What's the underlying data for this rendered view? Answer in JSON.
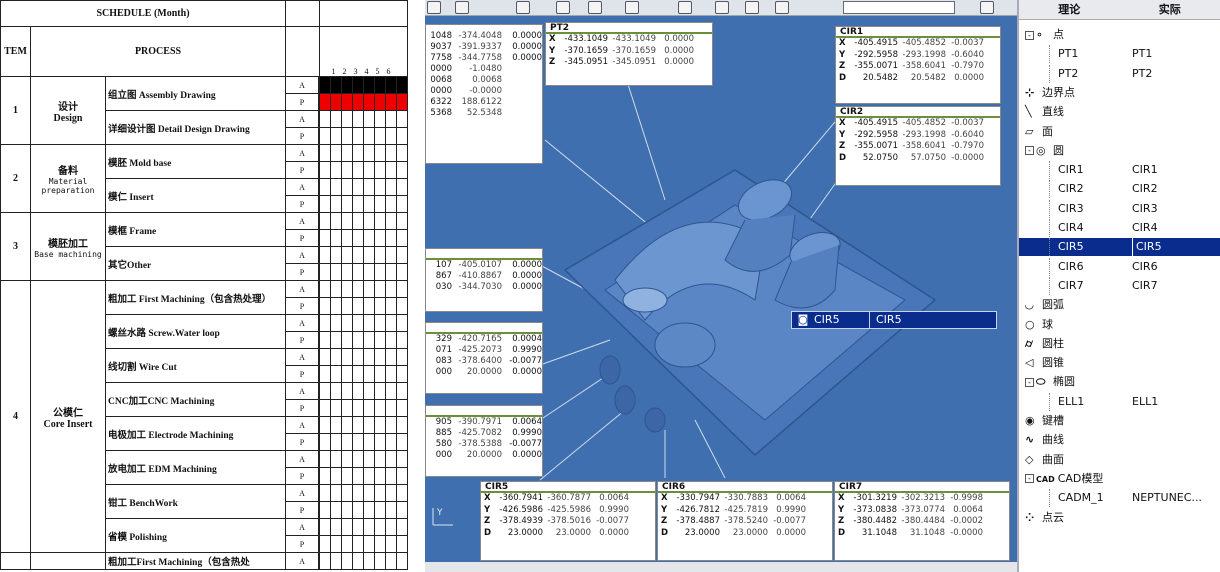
{
  "schedule": {
    "header_schedule": "SCHEDULE (Month)",
    "header_item": "TEM",
    "header_process": "PROCESS",
    "months": [
      "1",
      "2",
      "3",
      "4",
      "5",
      "6"
    ],
    "groups": [
      {
        "no": "1",
        "name_cn": "设计",
        "name_en": "Design",
        "rows": [
          {
            "label": "组立图 Assembly Drawing",
            "marks": [
              "A",
              "P"
            ]
          },
          {
            "label": "详细设计图  Detail Design Drawing",
            "marks": [
              "A",
              "P"
            ]
          }
        ]
      },
      {
        "no": "2",
        "name_cn": "备料",
        "name_en": "Material preparation",
        "rows": [
          {
            "label": "模胚 Mold base",
            "marks": [
              "A",
              "P"
            ]
          },
          {
            "label": "模仁 Insert",
            "marks": [
              "A",
              "P"
            ]
          }
        ]
      },
      {
        "no": "3",
        "name_cn": "模胚加工",
        "name_en": "Base machining",
        "rows": [
          {
            "label": "模框 Frame",
            "marks": [
              "A",
              "P"
            ]
          },
          {
            "label": "其它Other",
            "marks": [
              "A",
              "P"
            ]
          }
        ]
      },
      {
        "no": "4",
        "name_cn": "公模仁",
        "name_en": "Core Insert",
        "rows": [
          {
            "label": "粗加工 First Machining（包含热处理）",
            "marks": [
              "A",
              "P"
            ]
          },
          {
            "label": "螺丝水路 Screw.Water loop",
            "marks": [
              "A",
              "P"
            ]
          },
          {
            "label": "线切割 Wire Cut",
            "marks": [
              "A",
              "P"
            ]
          },
          {
            "label": "CNC加工CNC Machining",
            "marks": [
              "A",
              "P"
            ]
          },
          {
            "label": "电极加工 Electrode Machining",
            "marks": [
              "A",
              "P"
            ]
          },
          {
            "label": "放电加工 EDM Machining",
            "marks": [
              "A",
              "P"
            ]
          },
          {
            "label": "钳工 BenchWork",
            "marks": [
              "A",
              "P"
            ]
          },
          {
            "label": "省模 Polishing",
            "marks": [
              "A",
              "P"
            ]
          }
        ]
      }
    ],
    "last_row": {
      "label": "粗加工First Machining（包含热处",
      "mark": "A"
    }
  },
  "cad": {
    "panel_top_left": {
      "rows": [
        [
          "1048",
          "-374.4048",
          "0.0000"
        ],
        [
          "9037",
          "-391.9337",
          "0.0000"
        ],
        [
          "7758",
          "-344.7758",
          "0.0000"
        ],
        [
          "0000",
          "-1.0480",
          ""
        ],
        [
          "0068",
          "0.0068",
          ""
        ],
        [
          "0000",
          "-0.0000",
          ""
        ],
        [
          "6322",
          "188.6122",
          ""
        ],
        [
          "5368",
          "52.5348",
          ""
        ]
      ]
    },
    "panel_pt2": {
      "title": "PT2",
      "rows": [
        {
          "axis": "X",
          "a": "-433.1049",
          "b": "-433.1049",
          "c": "0.0000"
        },
        {
          "axis": "Y",
          "a": "-370.1659",
          "b": "-370.1659",
          "c": "0.0000"
        },
        {
          "axis": "Z",
          "a": "-345.0951",
          "b": "-345.0951",
          "c": "0.0000"
        }
      ]
    },
    "panel_cir1": {
      "title": "CIR1",
      "rows": [
        {
          "axis": "X",
          "a": "-405.4915",
          "b": "-405.4852",
          "c": "-0.0037"
        },
        {
          "axis": "Y",
          "a": "-292.5958",
          "b": "-293.1998",
          "c": "-0.6040"
        },
        {
          "axis": "Z",
          "a": "-355.0071",
          "b": "-358.6041",
          "c": "-0.7970"
        },
        {
          "axis": "D",
          "a": "20.5482",
          "b": "20.5482",
          "c": "0.0000"
        }
      ]
    },
    "panel_cir2": {
      "title": "CIR2",
      "rows": [
        {
          "axis": "X",
          "a": "-405.4915",
          "b": "-405.4852",
          "c": "-0.0037"
        },
        {
          "axis": "Y",
          "a": "-292.5958",
          "b": "-293.1998",
          "c": "-0.6040"
        },
        {
          "axis": "Z",
          "a": "-355.0071",
          "b": "-358.6041",
          "c": "-0.7970"
        },
        {
          "axis": "D",
          "a": "52.0750",
          "b": "57.0750",
          "c": "-0.0000"
        }
      ]
    },
    "panel_mid1": {
      "rows": [
        [
          "107",
          "-405.0107",
          "0.0000"
        ],
        [
          "867",
          "-410.8867",
          "0.0000"
        ],
        [
          "030",
          "-344.7030",
          "0.0000"
        ]
      ]
    },
    "panel_mid2": {
      "rows": [
        [
          "329",
          "-420.7165",
          "0.0004"
        ],
        [
          "071",
          "-425.2073",
          "0.9990"
        ],
        [
          "083",
          "-378.6400",
          "-0.0077"
        ],
        [
          "000",
          "20.0000",
          "0.0000"
        ]
      ]
    },
    "panel_mid3": {
      "rows": [
        [
          "905",
          "-390.7971",
          "0.0064"
        ],
        [
          "885",
          "-425.7082",
          "0.9990"
        ],
        [
          "580",
          "-378.5388",
          "-0.0077"
        ],
        [
          "000",
          "20.0000",
          "0.0000"
        ]
      ]
    },
    "panel_cir5": {
      "title": "CIR5",
      "rows": [
        {
          "axis": "X",
          "a": "-360.7941",
          "b": "-360.7877",
          "c": "0.0064"
        },
        {
          "axis": "Y",
          "a": "-426.5986",
          "b": "-425.5986",
          "c": "0.9990"
        },
        {
          "axis": "Z",
          "a": "-378.4939",
          "b": "-378.5016",
          "c": "-0.0077"
        },
        {
          "axis": "D",
          "a": "23.0000",
          "b": "23.0000",
          "c": "0.0000"
        }
      ]
    },
    "panel_cir6": {
      "title": "CIR6",
      "rows": [
        {
          "axis": "X",
          "a": "-330.7947",
          "b": "-330.7883",
          "c": "0.0064"
        },
        {
          "axis": "Y",
          "a": "-426.7812",
          "b": "-425.7819",
          "c": "0.9990"
        },
        {
          "axis": "Z",
          "a": "-378.4887",
          "b": "-378.5240",
          "c": "-0.0077"
        },
        {
          "axis": "D",
          "a": "23.0000",
          "b": "23.0000",
          "c": "0.0000"
        }
      ]
    },
    "panel_cir7": {
      "title": "CIR7",
      "rows": [
        {
          "axis": "X",
          "a": "-301.3219",
          "b": "-302.3213",
          "c": "-0.9998"
        },
        {
          "axis": "Y",
          "a": "-373.0838",
          "b": "-373.0774",
          "c": "0.0064"
        },
        {
          "axis": "Z",
          "a": "-380.4482",
          "b": "-380.4484",
          "c": "-0.0002"
        },
        {
          "axis": "D",
          "a": "31.1048",
          "b": "31.1048",
          "c": "-0.0000"
        }
      ]
    },
    "selection_label": {
      "name": "CIR5",
      "value": "CIR5"
    },
    "axis_label": "Y",
    "colors": {
      "viewport": "#3f6fae",
      "part": "#4f7fc2",
      "panel_bar": "#6b8f3a",
      "selection": "#0a2c8c"
    }
  },
  "tree": {
    "header": {
      "col1": "理论",
      "col2": "实际"
    },
    "items": [
      {
        "label": "点",
        "value": "",
        "level": 0,
        "expand": "-",
        "icon": "point-icon",
        "icon_glyph": "∘"
      },
      {
        "label": "PT1",
        "value": "PT1",
        "level": 1,
        "icon": "",
        "icon_glyph": ""
      },
      {
        "label": "PT2",
        "value": "PT2",
        "level": 1,
        "icon": "",
        "icon_glyph": ""
      },
      {
        "label": "边界点",
        "value": "",
        "level": 0,
        "icon": "boundary-point-icon",
        "icon_glyph": "⊹"
      },
      {
        "label": "直线",
        "value": "",
        "level": 0,
        "icon": "line-icon",
        "icon_glyph": "╲"
      },
      {
        "label": "面",
        "value": "",
        "level": 0,
        "icon": "plane-icon",
        "icon_glyph": "▱"
      },
      {
        "label": "圆",
        "value": "",
        "level": 0,
        "expand": "-",
        "icon": "circle-icon",
        "icon_glyph": "◎"
      },
      {
        "label": "CIR1",
        "value": "CIR1",
        "level": 1,
        "icon": "",
        "icon_glyph": ""
      },
      {
        "label": "CIR2",
        "value": "CIR2",
        "level": 1,
        "icon": "",
        "icon_glyph": ""
      },
      {
        "label": "CIR3",
        "value": "CIR3",
        "level": 1,
        "icon": "",
        "icon_glyph": ""
      },
      {
        "label": "CIR4",
        "value": "CIR4",
        "level": 1,
        "icon": "",
        "icon_glyph": ""
      },
      {
        "label": "CIR5",
        "value": "CIR5",
        "level": 1,
        "selected": true,
        "icon": "",
        "icon_glyph": ""
      },
      {
        "label": "CIR6",
        "value": "CIR6",
        "level": 1,
        "icon": "",
        "icon_glyph": ""
      },
      {
        "label": "CIR7",
        "value": "CIR7",
        "level": 1,
        "icon": "",
        "icon_glyph": ""
      },
      {
        "label": "圆弧",
        "value": "",
        "level": 0,
        "icon": "arc-icon",
        "icon_glyph": "◡"
      },
      {
        "label": "球",
        "value": "",
        "level": 0,
        "icon": "sphere-icon",
        "icon_glyph": "○"
      },
      {
        "label": "圆柱",
        "value": "",
        "level": 0,
        "icon": "cylinder-icon",
        "icon_glyph": "⌭"
      },
      {
        "label": "圆锥",
        "value": "",
        "level": 0,
        "icon": "cone-icon",
        "icon_glyph": "◁"
      },
      {
        "label": "椭圆",
        "value": "",
        "level": 0,
        "expand": "-",
        "icon": "ellipse-icon",
        "icon_glyph": "⬭"
      },
      {
        "label": "ELL1",
        "value": "ELL1",
        "level": 1,
        "icon": "",
        "icon_glyph": ""
      },
      {
        "label": "键槽",
        "value": "",
        "level": 0,
        "icon": "slot-icon",
        "icon_glyph": "◉"
      },
      {
        "label": "曲线",
        "value": "",
        "level": 0,
        "icon": "curve-icon",
        "icon_glyph": "∿"
      },
      {
        "label": "曲面",
        "value": "",
        "level": 0,
        "icon": "surface-icon",
        "icon_glyph": "◇"
      },
      {
        "label": "CAD模型",
        "value": "",
        "level": 0,
        "expand": "-",
        "icon": "cad-model-icon",
        "icon_glyph": "CAD"
      },
      {
        "label": "CADM_1",
        "value": "NEPTUNEC...",
        "level": 1,
        "icon": "",
        "icon_glyph": ""
      },
      {
        "label": "点云",
        "value": "",
        "level": 0,
        "icon": "point-cloud-icon",
        "icon_glyph": "⁘"
      }
    ]
  }
}
